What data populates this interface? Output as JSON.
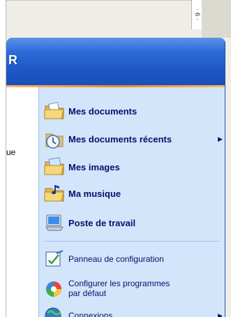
{
  "background": {
    "ruler_text": "· 6 ·"
  },
  "start_menu": {
    "user_label": "R",
    "left_item_partial": "ue",
    "items": [
      {
        "label": "Mes documents",
        "icon": "folder-documents-icon",
        "bold": true
      },
      {
        "label": "Mes documents récents",
        "icon": "recent-documents-icon",
        "bold": true,
        "submenu_arrow": "▶"
      },
      {
        "label": "Mes images",
        "icon": "folder-pictures-icon",
        "bold": true
      },
      {
        "label": "Ma musique",
        "icon": "folder-music-icon",
        "bold": true
      },
      {
        "label": "Poste de travail",
        "icon": "my-computer-icon",
        "bold": true
      },
      {
        "label": "Panneau de configuration",
        "icon": "control-panel-icon",
        "bold": false
      },
      {
        "label_line1": "Configurer les programmes",
        "label_line2": "par défaut",
        "icon": "set-default-programs-icon",
        "bold": false
      },
      {
        "label": "Connexions",
        "icon": "connections-icon",
        "bold": false,
        "submenu_arrow": "▶"
      }
    ]
  },
  "colors": {
    "header_blue": "#2c6bd8",
    "panel_blue": "#d3e5fa",
    "text_navy": "#00136b",
    "orange_accent": "#e98a2a"
  }
}
